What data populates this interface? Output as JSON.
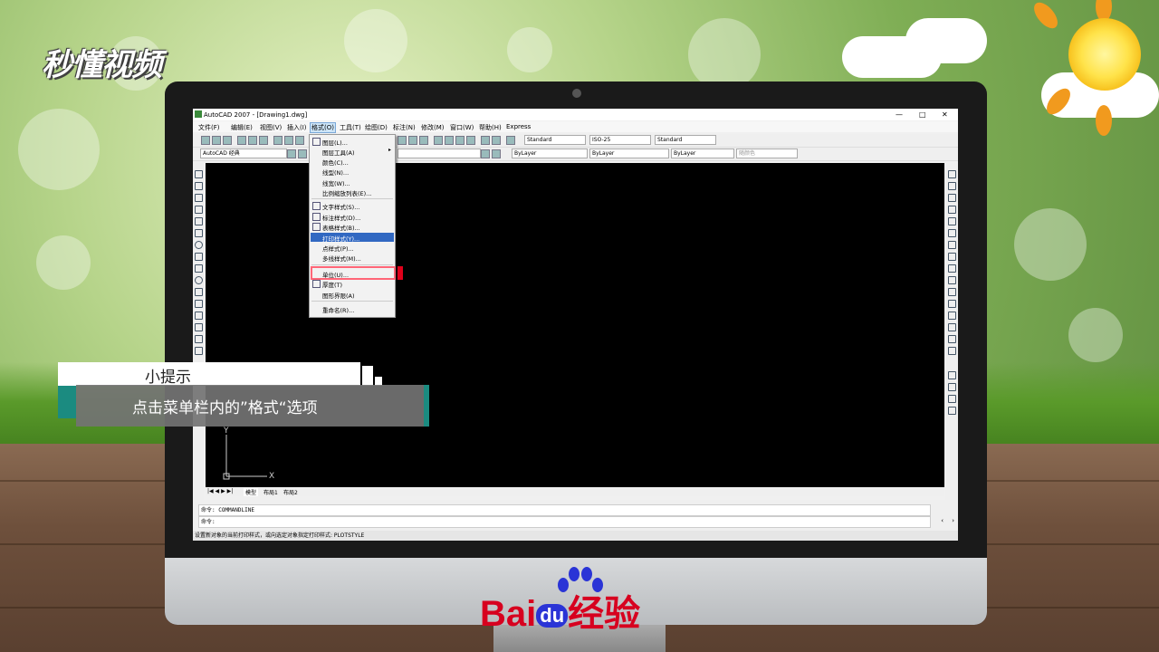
{
  "brand_logo": "秒懂视频",
  "monitor_brand": {
    "left": "Bai",
    "mid": "du",
    "right": "经验"
  },
  "app": {
    "title": "AutoCAD 2007 - [Drawing1.dwg]",
    "window_controls": [
      "—",
      "□",
      "✕"
    ],
    "menu": [
      "文件(F)",
      "编辑(E)",
      "视图(V)",
      "插入(I)",
      "格式(O)",
      "工具(T)",
      "绘图(D)",
      "标注(N)",
      "修改(M)",
      "窗口(W)",
      "帮助(H)",
      "Express"
    ],
    "active_menu": "格式(O)",
    "toolbar": {
      "text_style": "Standard",
      "dim_style": "ISO-25",
      "table_style": "Standard",
      "workspace": "AutoCAD 经典",
      "layer_color": "ByLayer",
      "linetype": "ByLayer",
      "lineweight": "ByLayer",
      "plot_style": "随颜色"
    },
    "format_menu": [
      {
        "label": "图层(L)...",
        "icon": "layers-icon"
      },
      {
        "label": "图层工具(A)",
        "submenu": true
      },
      {
        "label": "颜色(C)..."
      },
      {
        "label": "线型(N)..."
      },
      {
        "label": "线宽(W)..."
      },
      {
        "label": "比例缩放列表(E)..."
      },
      {
        "label": "文字样式(S)...",
        "icon": "text-style-icon"
      },
      {
        "label": "标注样式(D)...",
        "icon": "dim-style-icon"
      },
      {
        "label": "表格样式(B)...",
        "icon": "table-style-icon"
      },
      {
        "label": "打印样式(Y)...",
        "selected": true
      },
      {
        "label": "点样式(P)..."
      },
      {
        "label": "多线样式(M)..."
      },
      {
        "label": "单位(U)...",
        "highlighted": true
      },
      {
        "label": "厚度(T)",
        "icon": "thickness-icon"
      },
      {
        "label": "图形界限(A)"
      },
      {
        "label": "重命名(R)..."
      }
    ],
    "layout_tabs": [
      "模型",
      "布局1",
      "布局2"
    ],
    "axis": {
      "y": "Y",
      "x": "X"
    },
    "command_lines": [
      "命令: COMMANDLINE",
      "命令:"
    ],
    "status_text": "设置新对象的当前打印样式，或向选定对象指定打印样式:   PLOTSTYLE"
  },
  "tip": {
    "title": "小提示",
    "text": "点击菜单栏内的”格式“选项"
  },
  "colors": {
    "accent_teal": "#1b8b80",
    "highlight_red": "#e0001a",
    "menu_select": "#3168c2"
  }
}
